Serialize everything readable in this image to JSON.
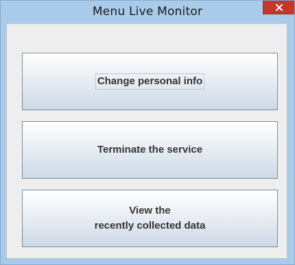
{
  "window": {
    "title": "Menu Live Monitor"
  },
  "buttons": {
    "change_personal_info": "Change personal info",
    "terminate_service": "Terminate the service",
    "view_data_line1": "View the",
    "view_data_line2": "recently collected data"
  },
  "colors": {
    "titlebar": "#a9cbe9",
    "close_button": "#c7352d",
    "content_bg": "#eeeeee"
  },
  "icons": {
    "close": "close-icon"
  }
}
